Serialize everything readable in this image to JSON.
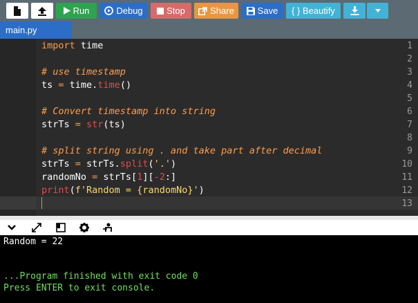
{
  "toolbar": {
    "run_label": "Run",
    "debug_label": "Debug",
    "stop_label": "Stop",
    "share_label": "Share",
    "save_label": "Save",
    "beautify_label": "{ } Beautify"
  },
  "tabs": [
    {
      "label": "main.py"
    }
  ],
  "editor": {
    "line_numbers": [
      "1",
      "2",
      "3",
      "4",
      "5",
      "6",
      "7",
      "8",
      "9",
      "10",
      "11",
      "12",
      "13"
    ],
    "lines": {
      "l1": {
        "kw": "import",
        "rest": " time"
      },
      "l3": {
        "comment": "# use timestamp"
      },
      "l4": {
        "a": "ts",
        "eq": " = ",
        "b": "time.",
        "fn": "time",
        "c": "()"
      },
      "l6": {
        "comment": "# Convert timestamp into string"
      },
      "l7": {
        "a": "strTs",
        "eq": " = ",
        "fn": "str",
        "c": "(ts)"
      },
      "l9": {
        "comment": "# split string using . and take part after decimal"
      },
      "l10": {
        "a": "strTs",
        "eq": " = ",
        "b": "strTs.",
        "fn": "split",
        "c": "(",
        "s": "'.'",
        "d": ")"
      },
      "l11": {
        "a": "randomNo",
        "eq": " = ",
        "b": "strTs[",
        "n1": "1",
        "c": "][",
        "n2": "-2",
        "d": ":]"
      },
      "l12": {
        "fn": "print",
        "c": "(",
        "s": "f'Random = {randomNo}'",
        "d": ")"
      }
    }
  },
  "console": {
    "output": "Random = 22",
    "finished": "...Program finished with exit code 0",
    "prompt": "Press ENTER to exit console."
  },
  "colors": {
    "run": "#2ea44f",
    "debug": "#2c6ec7",
    "stop": "#d96a6a",
    "share": "#e9963f",
    "beautify": "#42b3d6",
    "console_green": "#6fe05a"
  }
}
